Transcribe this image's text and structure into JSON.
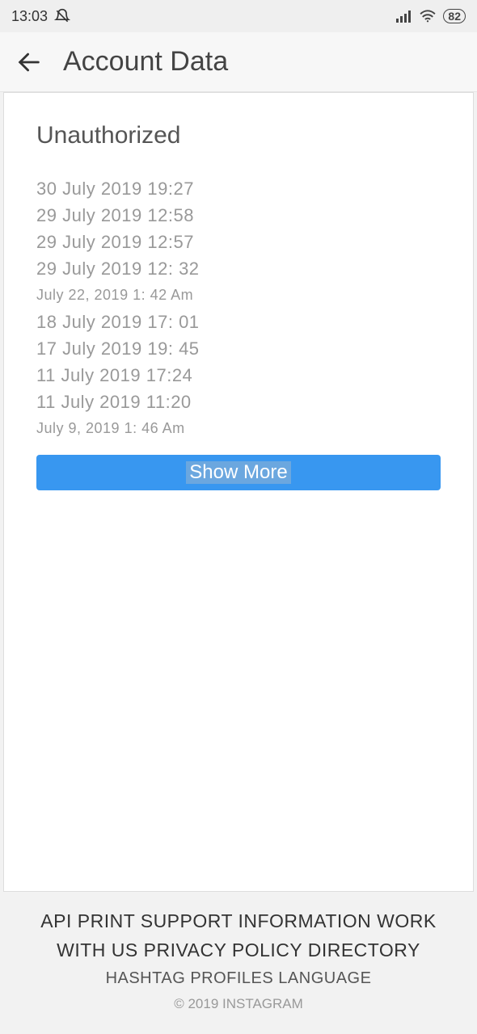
{
  "statusbar": {
    "time": "13:03",
    "battery": "82"
  },
  "header": {
    "title": "Account Data"
  },
  "section": {
    "heading": "Unauthorized",
    "entries": [
      {
        "text": "30 July 2019 19:27",
        "style": "normal"
      },
      {
        "text": "29 July 2019 12:58",
        "style": "normal"
      },
      {
        "text": "29 July 2019 12:57",
        "style": "normal"
      },
      {
        "text": "29 July 2019 12: 32",
        "style": "normal"
      },
      {
        "text": "July 22, 2019 1: 42 Am",
        "style": "small"
      },
      {
        "text": "18 July 2019 17: 01",
        "style": "normal"
      },
      {
        "text": "17 July 2019 19: 45",
        "style": "normal"
      },
      {
        "text": "11 July 2019 17:24",
        "style": "normal"
      },
      {
        "text": "11 July 2019 11:20",
        "style": "normal"
      },
      {
        "text": "July 9, 2019 1: 46 Am",
        "style": "small"
      }
    ],
    "show_more": "Show More"
  },
  "footer": {
    "row1": "API PRINT SUPPORT INFORMATION WORK WITH US PRIVACY POLICY DIRECTORY",
    "row2": "HASHTAG PROFILES LANGUAGE",
    "copyright": "© 2019 INSTAGRAM"
  }
}
